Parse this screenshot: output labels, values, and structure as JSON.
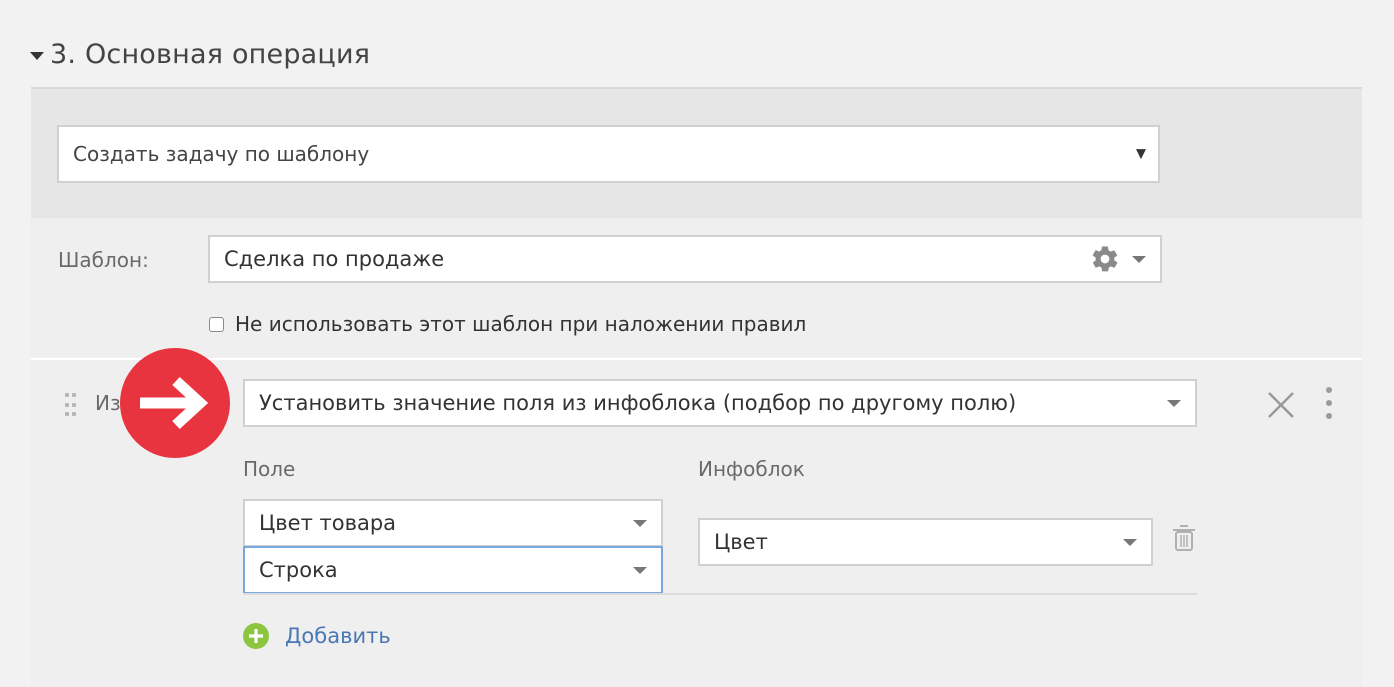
{
  "section": {
    "title": "3. Основная операция"
  },
  "operation_select": {
    "value": "Создать задачу по шаблону",
    "arrow": "▼"
  },
  "template": {
    "label": "Шаблон:",
    "value": "Сделка по продаже"
  },
  "checkbox": {
    "label": "Не использовать этот шаблон при наложении правил",
    "checked": false
  },
  "action_row": {
    "hidden_label": "Из",
    "select_value": "Установить значение поля из инфоблока (подбор по другому полю)"
  },
  "mapping": {
    "field_header": "Поле",
    "infoblock_header": "Инфоблок",
    "field_value": "Цвет товара",
    "field_type_value": "Строка",
    "infoblock_value": "Цвет"
  },
  "add_link": {
    "label": "Добавить"
  },
  "colors": {
    "marker_red": "#e8343f",
    "link_blue": "#4a78b4",
    "plus_green": "#8cc63f",
    "focus_blue": "#7aa7d9"
  },
  "icons": [
    "caret-down-icon",
    "gear-icon",
    "arrow-right-icon",
    "close-icon",
    "kebab-menu-icon",
    "trash-icon",
    "plus-circle-icon",
    "drag-handle-icon"
  ]
}
